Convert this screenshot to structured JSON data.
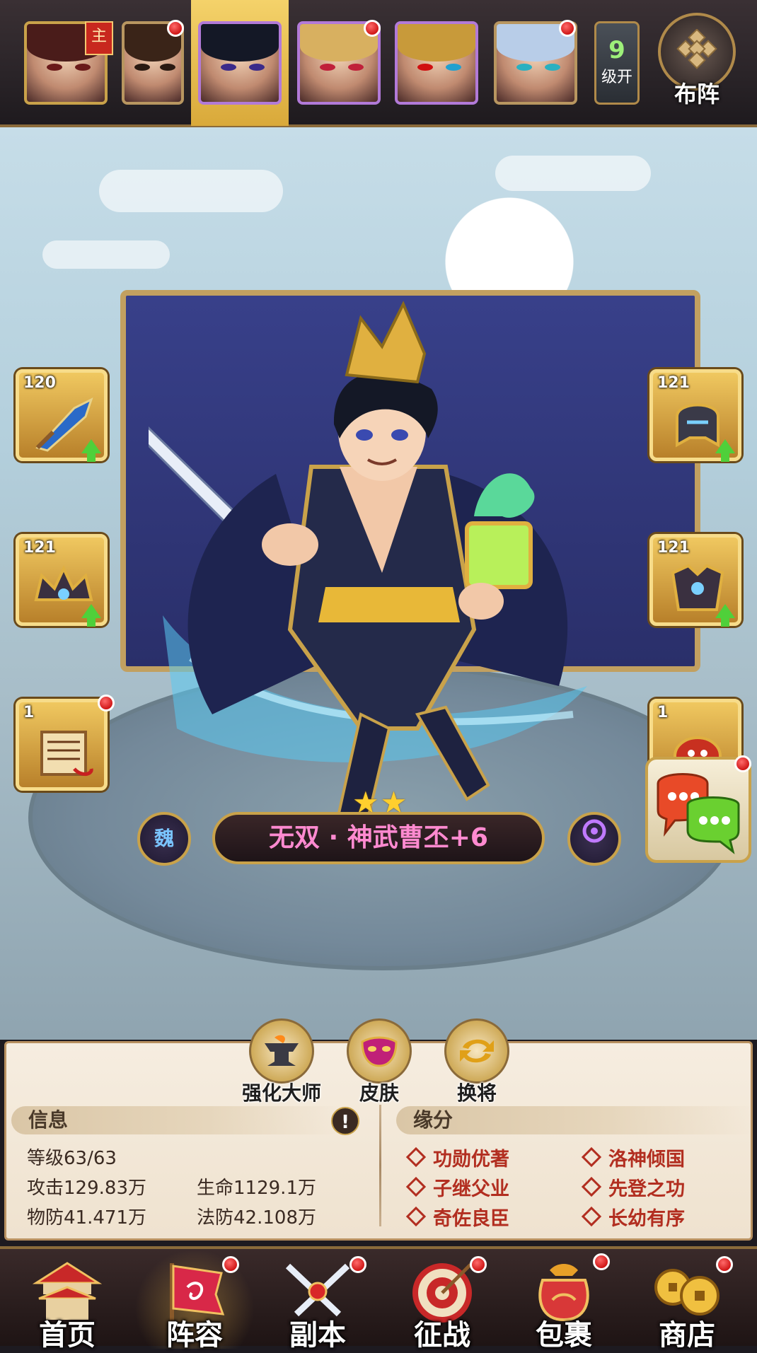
{
  "top_bar": {
    "lord_badge": "主",
    "level_tile": {
      "number": "9",
      "text": "级开"
    },
    "formation_label": "布阵"
  },
  "equipment": {
    "left": [
      {
        "level": "120",
        "icon": "glaive-weapon-icon",
        "upgradable": true
      },
      {
        "level": "121",
        "icon": "crown-helmet-icon",
        "upgradable": true
      },
      {
        "level": "1",
        "icon": "scroll-treasure-icon",
        "upgradable": false
      }
    ],
    "right": [
      {
        "level": "121",
        "icon": "helmet-armor-icon",
        "upgradable": true
      },
      {
        "level": "121",
        "icon": "chest-armor-icon",
        "upgradable": true
      },
      {
        "level": "1",
        "icon": "beast-mount-icon",
        "upgradable": false
      }
    ]
  },
  "hero": {
    "name": "无双 · 神武曹丕+6",
    "faction": "魏",
    "stars": 2,
    "name_color": "#ff8ad0"
  },
  "actions": [
    {
      "label": "强化大师",
      "icon": "anvil-icon"
    },
    {
      "label": "皮肤",
      "icon": "mask-icon"
    },
    {
      "label": "换将",
      "icon": "swap-icon"
    }
  ],
  "info": {
    "title": "信息",
    "info_button": "!",
    "level": {
      "label": "等级",
      "value": "63/63"
    },
    "attack": {
      "label": "攻击",
      "value": "129.83万"
    },
    "hp": {
      "label": "生命",
      "value": "1129.1万"
    },
    "pdef": {
      "label": "物防",
      "value": "41.471万"
    },
    "mdef": {
      "label": "法防",
      "value": "42.108万"
    }
  },
  "bonds": {
    "title": "缘分",
    "items": [
      "功勋优著",
      "洛神倾国",
      "子继父业",
      "先登之功",
      "奇佐良臣",
      "长幼有序"
    ]
  },
  "bottom_nav": [
    {
      "label": "首页",
      "icon": "palace-icon",
      "badge": false,
      "active": false
    },
    {
      "label": "阵容",
      "icon": "war-flag-icon",
      "badge": true,
      "active": true
    },
    {
      "label": "副本",
      "icon": "crossed-swords-icon",
      "badge": true,
      "active": false
    },
    {
      "label": "征战",
      "icon": "target-icon",
      "badge": true,
      "active": false
    },
    {
      "label": "包裹",
      "icon": "bag-icon",
      "badge": true,
      "active": false
    },
    {
      "label": "商店",
      "icon": "coins-icon",
      "badge": true,
      "active": false
    }
  ],
  "colors": {
    "gold": "#c9a24a",
    "badge_red": "#d01818",
    "bond_red": "#b22e20",
    "upgrade_green": "#4fd03a"
  }
}
